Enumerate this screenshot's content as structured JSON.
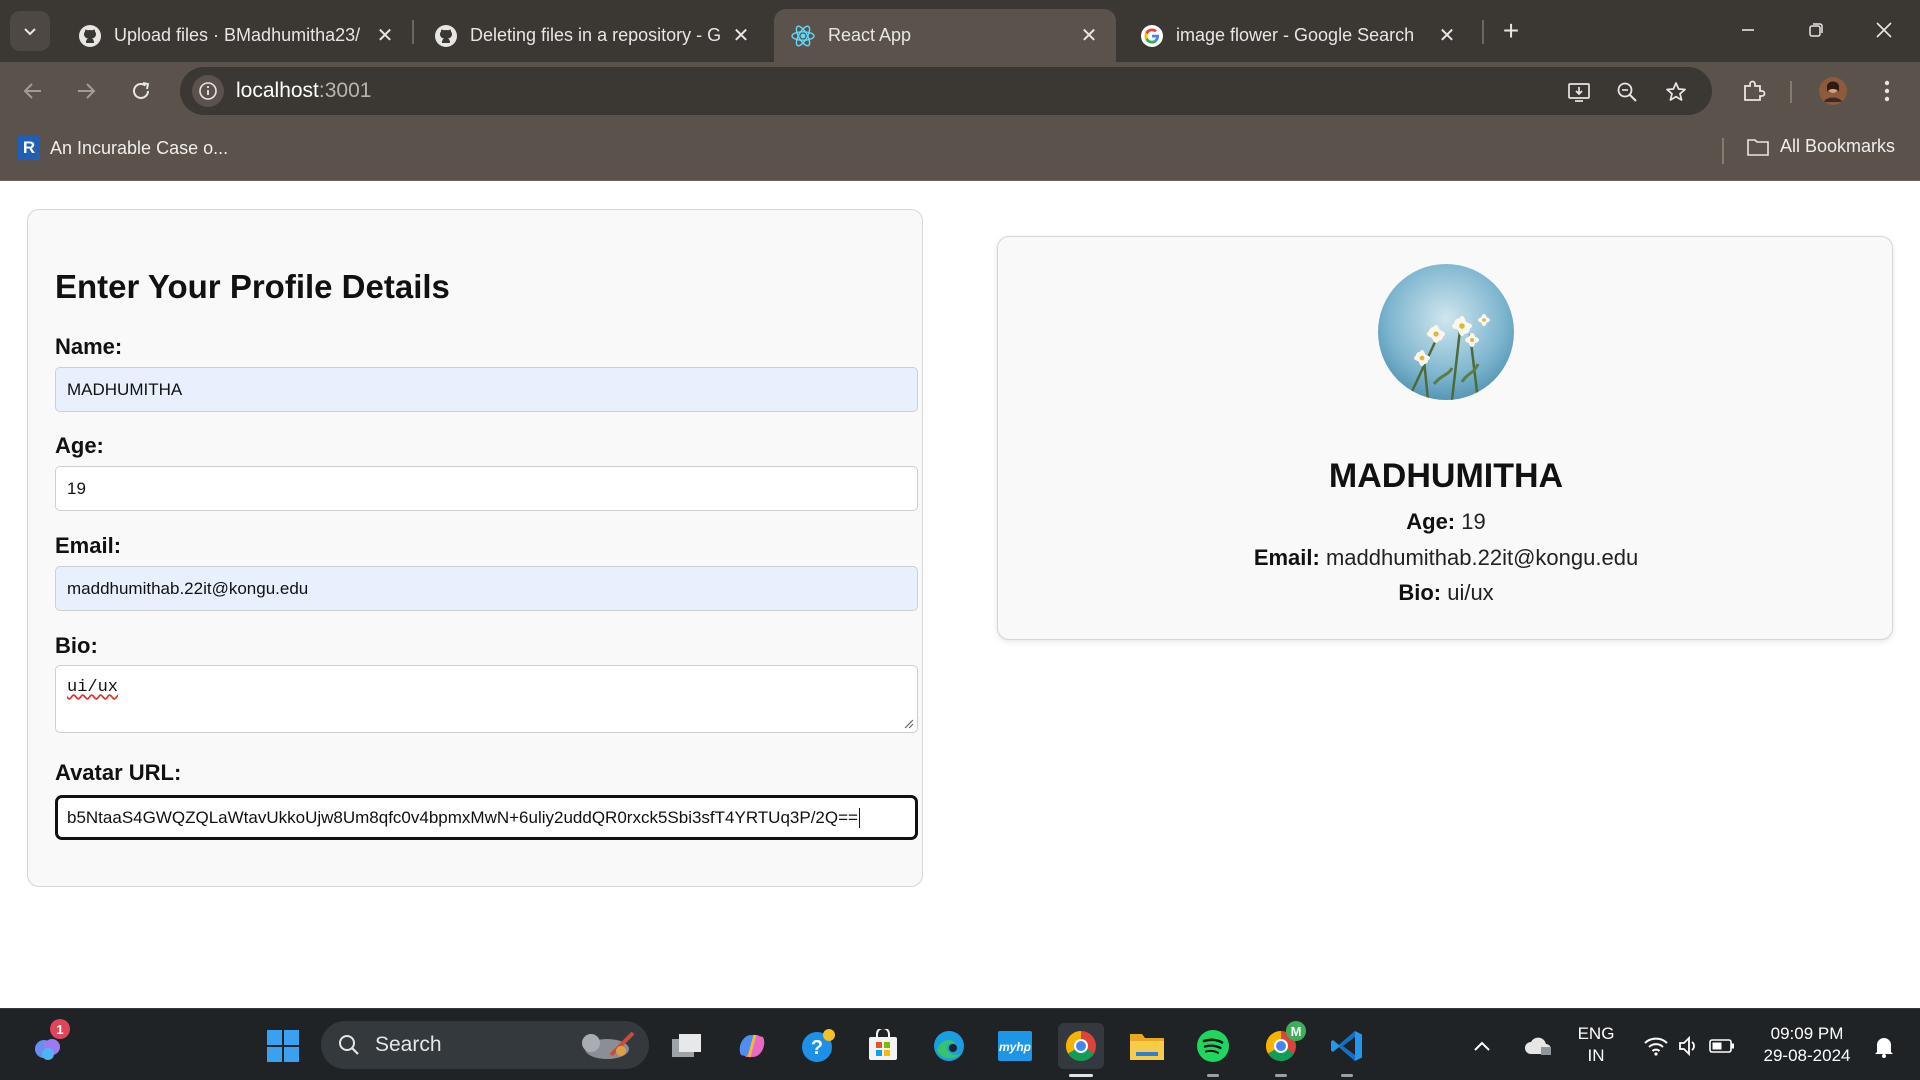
{
  "browser": {
    "tabs": [
      {
        "title": "Upload files · BMadhumitha23/",
        "icon": "github-icon",
        "active": false
      },
      {
        "title": "Deleting files in a repository - G",
        "icon": "github-icon",
        "active": false
      },
      {
        "title": "React App",
        "icon": "react-icon",
        "active": true
      },
      {
        "title": "image flower - Google Search",
        "icon": "google-icon",
        "active": false
      }
    ],
    "tab_close_glyph": "✕",
    "new_tab_glyph": "+",
    "url_host": "localhost",
    "url_port": ":3001",
    "bookmark": {
      "label": "An Incurable Case o...",
      "favicon_letter": "R"
    },
    "all_bookmarks_label": "All Bookmarks"
  },
  "form": {
    "title": "Enter Your Profile Details",
    "name_label": "Name:",
    "name_value": "MADHUMITHA",
    "age_label": "Age:",
    "age_value": "19",
    "email_label": "Email:",
    "email_value": "maddhumithab.22it@kongu.edu",
    "bio_label": "Bio:",
    "bio_value": "ui/ux",
    "avatar_label": "Avatar URL:",
    "avatar_value": "b5NtaaS4GWQZQLaWtavUkkoUjw8Um8qfc0v4bpmxMwN+6uliy2uddQR0rxck5Sbi3sfT4YRTUq3P/2Q=="
  },
  "profile": {
    "name": "MADHUMITHA",
    "age_label": "Age:",
    "age": "19",
    "email_label": "Email:",
    "email": "maddhumithab.22it@kongu.edu",
    "bio_label": "Bio:",
    "bio": "ui/ux"
  },
  "taskbar": {
    "search_label": "Search",
    "notification_count": "1",
    "lang_top": "ENG",
    "lang_bottom": "IN",
    "time": "09:09 PM",
    "date": "29-08-2024",
    "chrome_profile_letter": "M"
  },
  "colors": {
    "chrome_dark": "#3b3733",
    "chrome_mid": "#5a524b",
    "autofill": "#e8f0fe",
    "card_bg": "#f9f9f9",
    "taskbar_bg": "#1f2326"
  }
}
